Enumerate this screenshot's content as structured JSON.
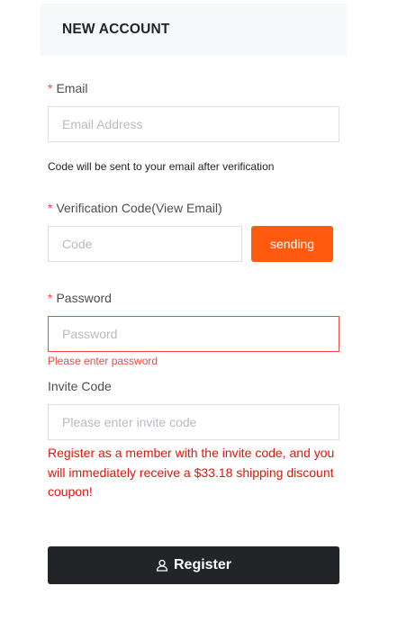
{
  "header": {
    "title": "NEW ACCOUNT"
  },
  "form": {
    "required_mark": "*",
    "email": {
      "label": "Email",
      "placeholder": "Email Address",
      "value": ""
    },
    "email_hint": "Code will be sent to your email after verification",
    "verification": {
      "label": "Verification Code(View Email)",
      "placeholder": "Code",
      "value": "",
      "button_label": "sending"
    },
    "password": {
      "label": "Password",
      "placeholder": "Password",
      "value": "",
      "error": "Please enter password"
    },
    "invite": {
      "label": "Invite Code",
      "placeholder": "Please enter invite code",
      "value": ""
    },
    "promo_text": "Register as a member with the invite code, and you will immediately receive a $33.18 shipping discount coupon!",
    "register_button": {
      "label": "Register",
      "icon": "user-icon"
    }
  },
  "colors": {
    "accent": "#ff5a0e",
    "error": "#f0483e",
    "promo": "#e8120c",
    "dark": "#222428"
  }
}
